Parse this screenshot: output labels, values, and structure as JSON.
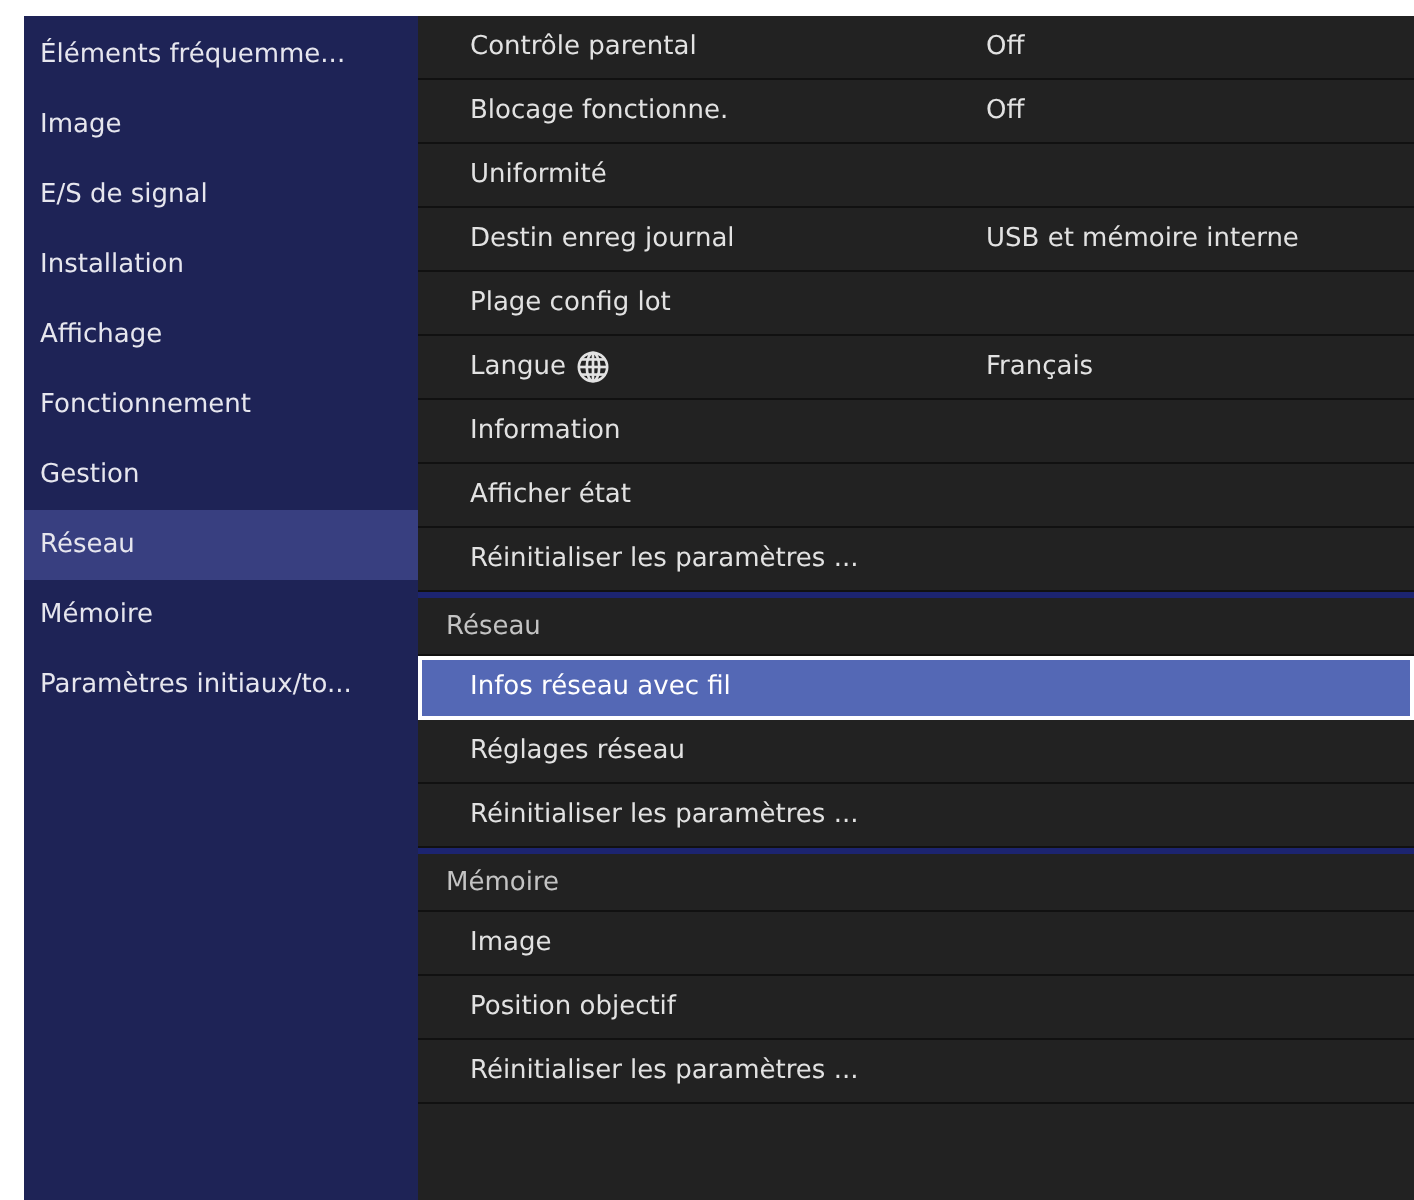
{
  "sidebar": {
    "items": [
      {
        "label": "Éléments fréquemme...",
        "selected": false
      },
      {
        "label": "Image",
        "selected": false
      },
      {
        "label": "E/S de signal",
        "selected": false
      },
      {
        "label": "Installation",
        "selected": false
      },
      {
        "label": "Affichage",
        "selected": false
      },
      {
        "label": "Fonctionnement",
        "selected": false
      },
      {
        "label": "Gestion",
        "selected": false
      },
      {
        "label": "Réseau",
        "selected": true
      },
      {
        "label": "Mémoire",
        "selected": false
      },
      {
        "label": "Paramètres initiaux/to...",
        "selected": false
      }
    ]
  },
  "sections": [
    {
      "items": [
        {
          "kind": "setting",
          "label": "Contrôle parental",
          "value": "Off",
          "selected": false
        },
        {
          "kind": "setting",
          "label": "Blocage fonctionne.",
          "value": "Off",
          "selected": false
        },
        {
          "kind": "setting",
          "label": "Uniformité",
          "selected": false
        },
        {
          "kind": "setting",
          "label": "Destin enreg journal",
          "value": "USB et mémoire interne",
          "selected": false
        },
        {
          "kind": "setting",
          "label": "Plage config lot",
          "selected": false
        },
        {
          "kind": "language",
          "label": "Langue",
          "value": "Français",
          "selected": false
        },
        {
          "kind": "setting",
          "label": "Information",
          "selected": false
        },
        {
          "kind": "setting",
          "label": "Afficher état",
          "selected": false
        },
        {
          "kind": "setting",
          "label": "Réinitialiser les paramètres ...",
          "selected": false
        }
      ]
    },
    {
      "header": "Réseau",
      "items": [
        {
          "kind": "setting",
          "label": "Infos réseau avec fil",
          "selected": true
        },
        {
          "kind": "setting",
          "label": "Réglages réseau",
          "selected": false
        },
        {
          "kind": "setting",
          "label": "Réinitialiser les paramètres ...",
          "selected": false
        }
      ]
    },
    {
      "header": "Mémoire",
      "items": [
        {
          "kind": "setting",
          "label": "Image",
          "selected": false
        },
        {
          "kind": "setting",
          "label": "Position objectif",
          "selected": false
        },
        {
          "kind": "setting",
          "label": "Réinitialiser les paramètres ...",
          "selected": false
        }
      ]
    }
  ]
}
